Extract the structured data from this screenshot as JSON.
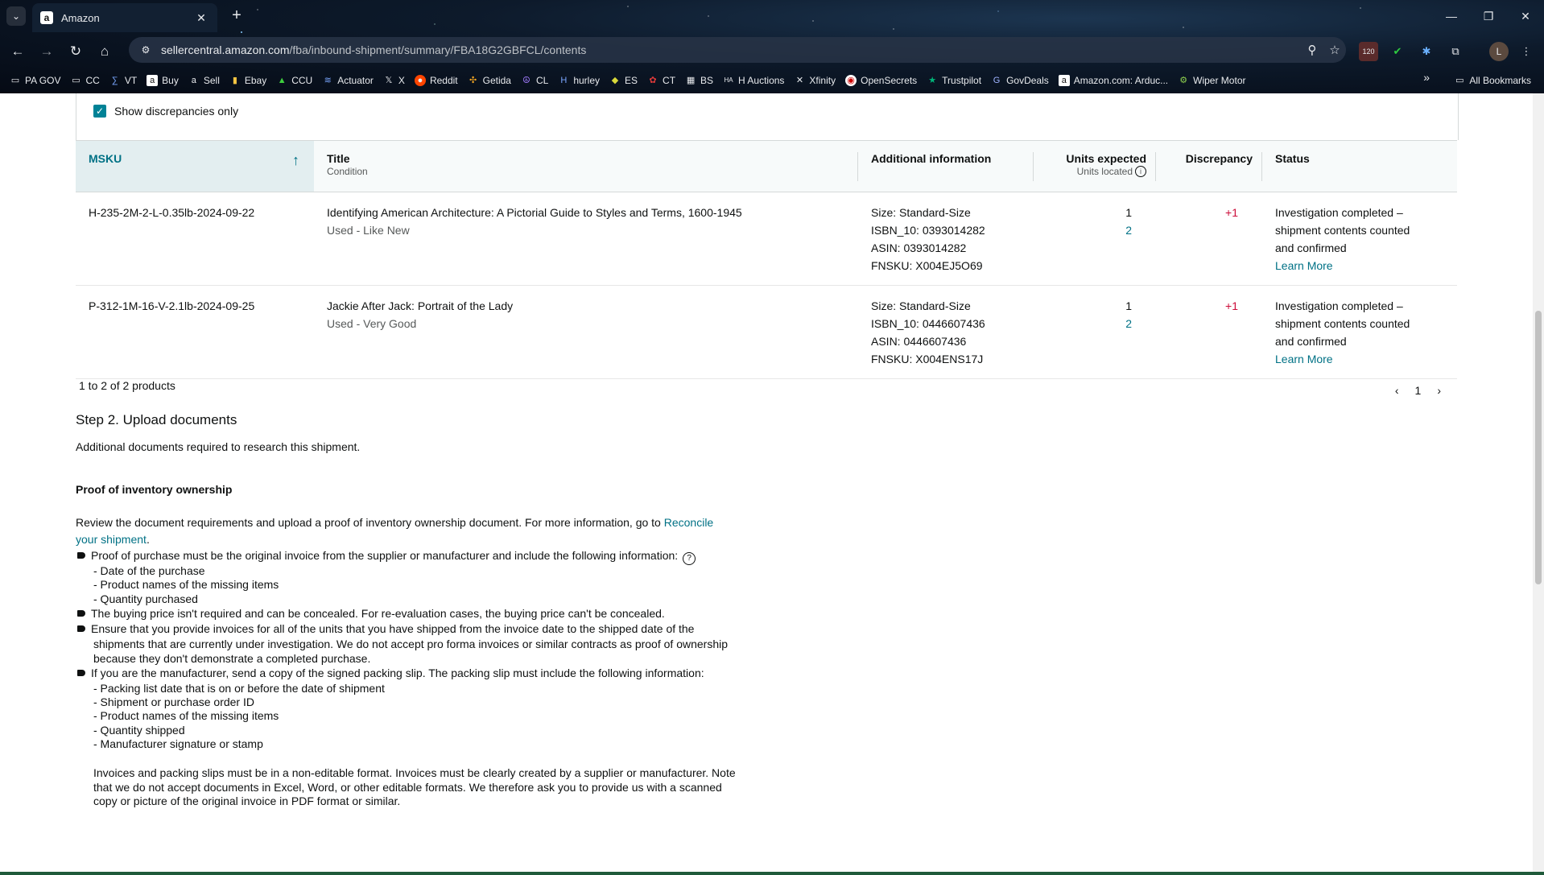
{
  "browser": {
    "tab_title": "Amazon",
    "url_domain": "sellercentral.amazon.com",
    "url_path": "/fba/inbound-shipment/summary/FBA18G2GBFCL/contents",
    "ext_badge": "120",
    "profile_initial": "L",
    "bookmarks": [
      "PA GOV",
      "CC",
      "VT",
      "Buy",
      "Sell",
      "Ebay",
      "CCU",
      "Actuator",
      "X",
      "Reddit",
      "Getida",
      "CL",
      "hurley",
      "ES",
      "CT",
      "BS",
      "H Auctions",
      "Xfinity",
      "OpenSecrets",
      "Trustpilot",
      "GovDeals",
      "Amazon.com: Arduc...",
      "Wiper Motor"
    ],
    "all_bookmarks": "All Bookmarks"
  },
  "filter": {
    "show_discrepancies_label": "Show discrepancies only",
    "checked": true
  },
  "table": {
    "headers": {
      "msku": "MSKU",
      "title": "Title",
      "title_sub": "Condition",
      "additional": "Additional information",
      "units_expected": "Units expected",
      "units_located": "Units located",
      "discrepancy": "Discrepancy",
      "status": "Status"
    },
    "rows": [
      {
        "msku": "H-235-2M-2-L-0.35lb-2024-09-22",
        "title": "Identifying American Architecture: A Pictorial Guide to Styles and Terms, 1600-1945",
        "condition": "Used - Like New",
        "size": "Size: Standard-Size",
        "isbn": "ISBN_10: 0393014282",
        "asin": "ASIN: 0393014282",
        "fnsku": "FNSKU: X004EJ5O69",
        "expected": "1",
        "located": "2",
        "discrepancy": "+1",
        "status1": "Investigation completed –",
        "status2": "shipment contents counted",
        "status3": "and confirmed",
        "learn_more": "Learn More"
      },
      {
        "msku": "P-312-1M-16-V-2.1lb-2024-09-25",
        "title": "Jackie After Jack: Portrait of the Lady",
        "condition": "Used - Very Good",
        "size": "Size: Standard-Size",
        "isbn": "ISBN_10: 0446607436",
        "asin": "ASIN: 0446607436",
        "fnsku": "FNSKU: X004ENS17J",
        "expected": "1",
        "located": "2",
        "discrepancy": "+1",
        "status1": "Investigation completed –",
        "status2": "shipment contents counted",
        "status3": "and confirmed",
        "learn_more": "Learn More"
      }
    ],
    "count_text": "1 to 2 of 2 products",
    "page": "1"
  },
  "step2": {
    "heading": "Step 2. Upload documents",
    "note": "Additional documents required to research this shipment.",
    "proof_heading": "Proof of inventory ownership",
    "intro_text": "Review the document requirements and upload a proof of inventory ownership document. For more information, go to ",
    "intro_link_1": "Reconcile",
    "intro_link_2": "your shipment",
    "intro_end": ".",
    "bullet1": "Proof of purchase must be the original invoice from the supplier or manufacturer and include the following information:",
    "bullet1_items": [
      "- Date of the purchase",
      "- Product names of the missing items",
      "- Quantity purchased"
    ],
    "bullet2": "The buying price isn't required and can be concealed. For re-evaluation cases, the buying price can't be concealed.",
    "bullet3_l1": "Ensure that you provide invoices for all of the units that you have shipped from the invoice date to the shipped date of the",
    "bullet3_l2": "shipments that are currently under investigation. We do not accept pro forma invoices or similar contracts as proof of ownership",
    "bullet3_l3": "because they don't demonstrate a completed purchase.",
    "bullet4": "If you are the manufacturer, send a copy of the signed packing slip. The packing slip must include the following information:",
    "bullet4_items": [
      "- Packing list date that is on or before the date of shipment",
      "- Shipment or purchase order ID",
      "- Product names of the missing items",
      "- Quantity shipped",
      "- Manufacturer signature or stamp"
    ],
    "para_l1": "Invoices and packing slips must be in a non-editable format. Invoices must be clearly created by a supplier or manufacturer. Note",
    "para_l2": "that we do not accept documents in Excel, Word, or other editable formats. We therefore ask you to provide us with a scanned",
    "para_l3": "copy or picture of the original invoice in PDF format or similar."
  }
}
